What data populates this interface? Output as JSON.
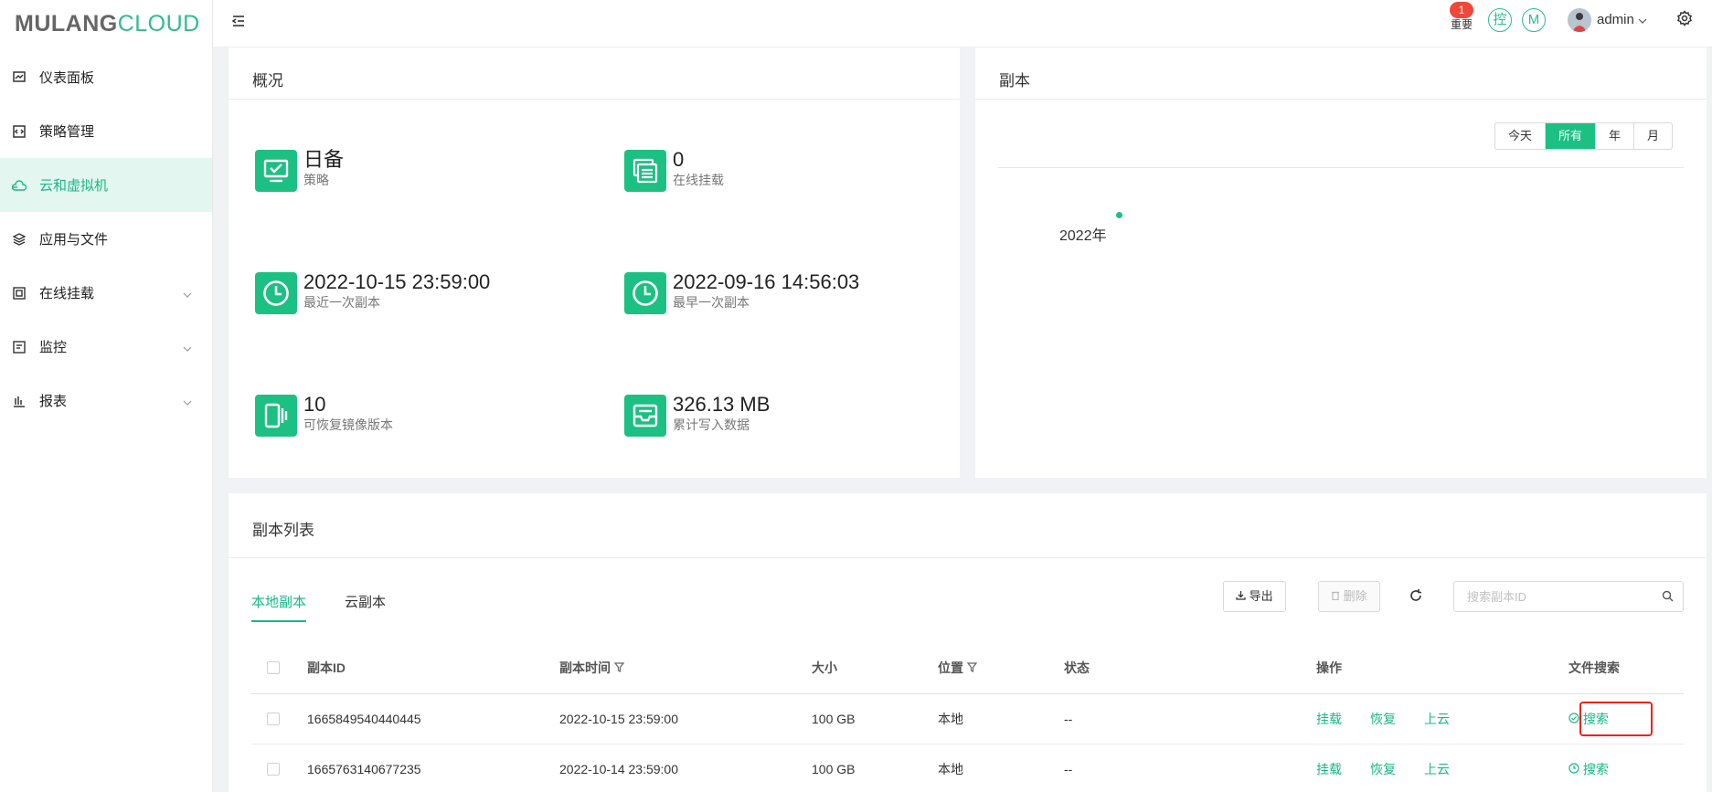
{
  "brand": {
    "part1": "MULANG",
    "part2": "CLOUD"
  },
  "sidebar": {
    "items": [
      {
        "label": "仪表面板",
        "icon": "dashboard-icon",
        "active": false,
        "expandable": false
      },
      {
        "label": "策略管理",
        "icon": "policy-icon",
        "active": false,
        "expandable": false
      },
      {
        "label": "云和虚拟机",
        "icon": "cloud-vm-icon",
        "active": true,
        "expandable": false
      },
      {
        "label": "应用与文件",
        "icon": "layers-icon",
        "active": false,
        "expandable": false
      },
      {
        "label": "在线挂载",
        "icon": "mount-icon",
        "active": false,
        "expandable": true
      },
      {
        "label": "监控",
        "icon": "monitor-icon",
        "active": false,
        "expandable": true
      },
      {
        "label": "报表",
        "icon": "report-icon",
        "active": false,
        "expandable": true
      }
    ]
  },
  "header": {
    "alert_count": "1",
    "alert_label": "重要",
    "ctrl_glyph": "控",
    "m_glyph": "M",
    "username": "admin"
  },
  "overview": {
    "title": "概况",
    "stats": [
      {
        "value": "日备",
        "label": "策略",
        "icon": "monitor-check-icon"
      },
      {
        "value": "0",
        "label": "在线挂载",
        "icon": "list-window-icon"
      },
      {
        "value": "2022-10-15 23:59:00",
        "label": "最近一次副本",
        "icon": "clock-icon"
      },
      {
        "value": "2022-09-16 14:56:03",
        "label": "最早一次副本",
        "icon": "clock-icon"
      },
      {
        "value": "10",
        "label": "可恢复镜像版本",
        "icon": "versions-icon"
      },
      {
        "value": "326.13 MB",
        "label": "累计写入数据",
        "icon": "inbox-icon"
      }
    ]
  },
  "replica": {
    "title": "副本",
    "filters": [
      "今天",
      "所有",
      "年",
      "月"
    ],
    "active_filter": "所有",
    "timeline_label": "2022年"
  },
  "replica_list": {
    "title": "副本列表",
    "tabs": [
      "本地副本",
      "云副本"
    ],
    "active_tab": "本地副本",
    "export_label": "导出",
    "delete_label": "删除",
    "search_placeholder": "搜索副本ID",
    "columns": [
      "副本ID",
      "副本时间",
      "大小",
      "位置",
      "状态",
      "操作",
      "文件搜索"
    ],
    "rows": [
      {
        "id": "1665849540440445",
        "time": "2022-10-15 23:59:00",
        "size": "100 GB",
        "location": "本地",
        "status": "--",
        "ops": [
          "挂载",
          "恢复",
          "上云"
        ],
        "search": "搜索"
      },
      {
        "id": "1665763140677235",
        "time": "2022-10-14 23:59:00",
        "size": "100 GB",
        "location": "本地",
        "status": "--",
        "ops": [
          "挂载",
          "恢复",
          "上云"
        ],
        "search": "搜索"
      }
    ]
  },
  "colors": {
    "accent": "#1cc083",
    "highlight": "#e8241c",
    "badge": "#f0473b"
  }
}
